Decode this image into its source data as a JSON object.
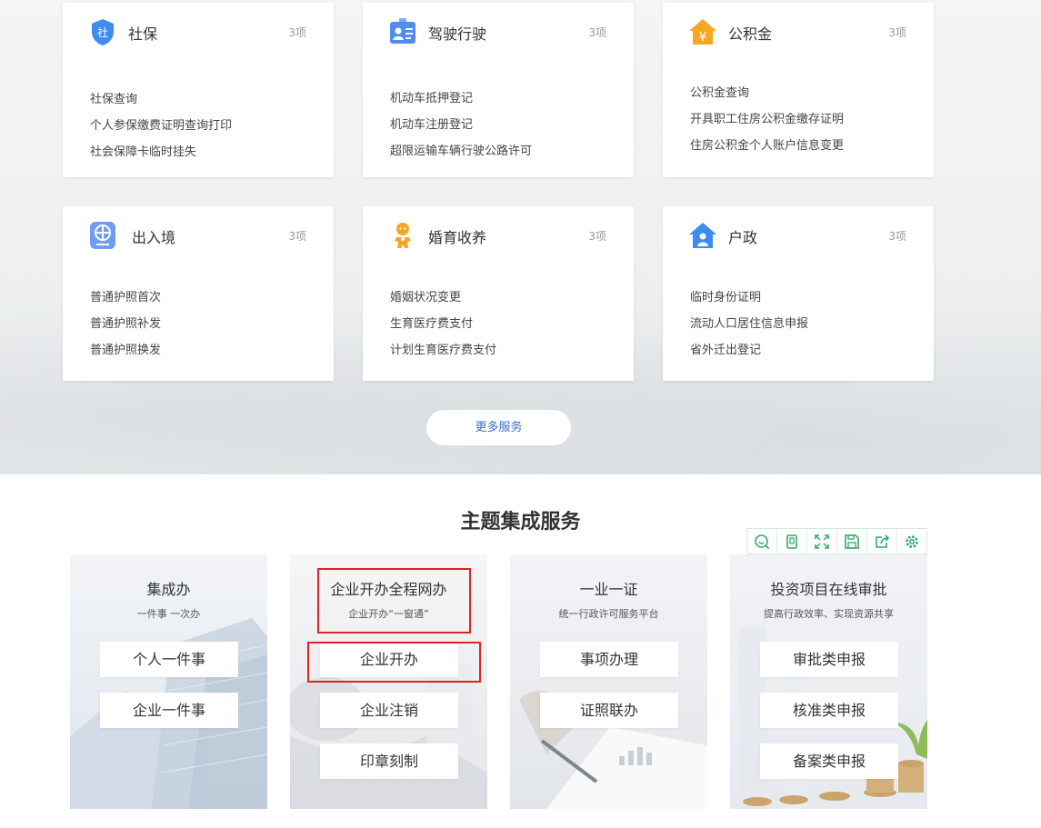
{
  "cards": [
    {
      "title": "社保",
      "count": "3项",
      "icon": "social-security-shield-icon",
      "color": "#3d8df0",
      "items": [
        "社保查询",
        "个人参保缴费证明查询打印",
        "社会保障卡临时挂失"
      ]
    },
    {
      "title": "驾驶行驶",
      "count": "3项",
      "icon": "driver-id-card-icon",
      "color": "#4f8cf0",
      "items": [
        "机动车抵押登记",
        "机动车注册登记",
        "超限运输车辆行驶公路许可"
      ]
    },
    {
      "title": "公积金",
      "count": "3项",
      "icon": "provident-fund-house-icon",
      "color": "#f5a623",
      "items": [
        "公积金查询",
        "开具职工住房公积金缴存证明",
        "住房公积金个人账户信息变更"
      ]
    },
    {
      "title": "出入境",
      "count": "3项",
      "icon": "passport-globe-icon",
      "color": "#5a8ef0",
      "items": [
        "普通护照首次",
        "普通护照补发",
        "普通护照换发"
      ]
    },
    {
      "title": "婚育收养",
      "count": "3项",
      "icon": "baby-icon",
      "color": "#f5a623",
      "items": [
        "婚姻状况变更",
        "生育医疗费支付",
        "计划生育医疗费支付"
      ]
    },
    {
      "title": "户政",
      "count": "3项",
      "icon": "household-house-icon",
      "color": "#3d8df0",
      "items": [
        "临时身份证明",
        "流动人口居住信息申报",
        "省外迁出登记"
      ]
    }
  ],
  "more_button": "更多服务",
  "section_title": "主题集成服务",
  "toolbar_icons": [
    "search-icon",
    "copy-icon",
    "fullscreen-icon",
    "save-icon",
    "share-icon",
    "settings-icon"
  ],
  "tiles": [
    {
      "title": "集成办",
      "subtitle": "一件事 一次办",
      "buttons": [
        "个人一件事",
        "企业一件事"
      ]
    },
    {
      "title": "企业开办全程网办",
      "subtitle": "企业开办“一窗通”",
      "buttons": [
        "企业开办",
        "企业注销",
        "印章刻制"
      ]
    },
    {
      "title": "一业一证",
      "subtitle": "统一行政许可服务平台",
      "buttons": [
        "事项办理",
        "证照联办"
      ]
    },
    {
      "title": "投资项目在线审批",
      "subtitle": "提高行政效率、实现资源共享",
      "buttons": [
        "审批类申报",
        "核准类申报",
        "备案类申报"
      ]
    }
  ]
}
